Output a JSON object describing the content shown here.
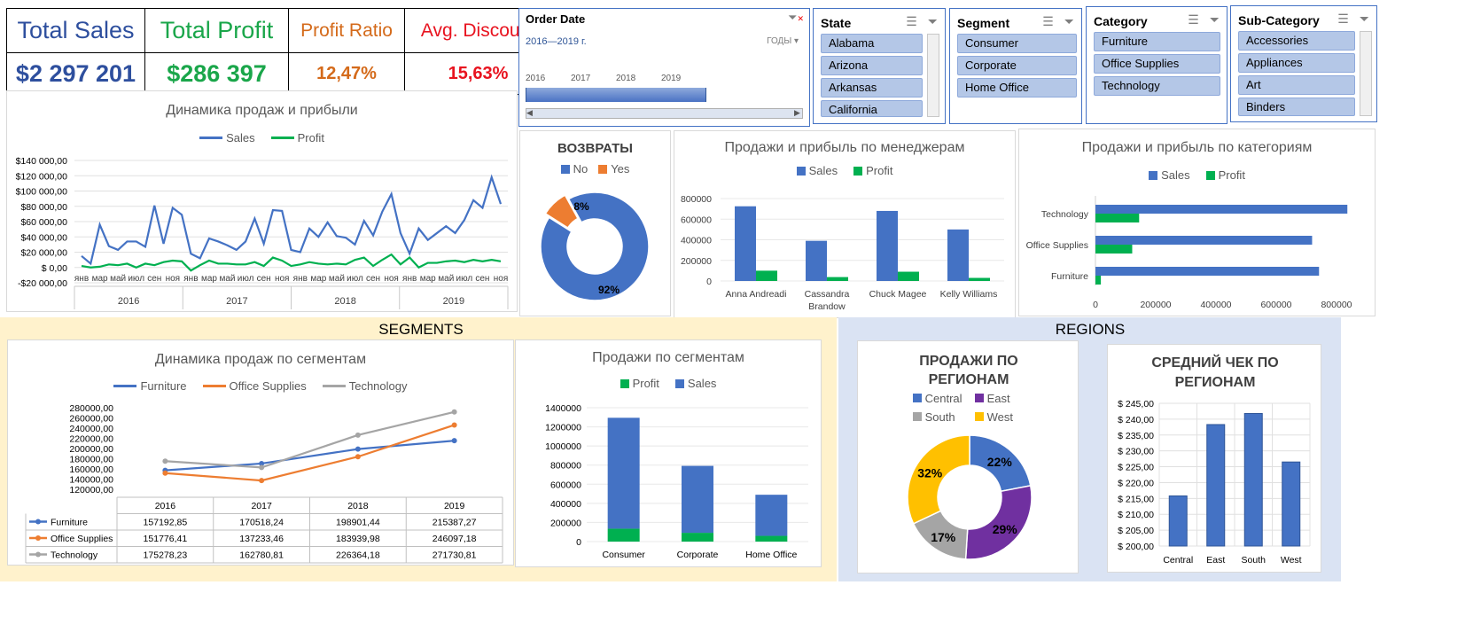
{
  "kpi": {
    "headers": [
      "Total Sales",
      "Total Profit",
      "Profit Ratio",
      "Avg. Discount"
    ],
    "values": [
      "$2 297 201",
      "$286 397",
      "12,47%",
      "15,63%"
    ],
    "colors": [
      "#2e4f9e",
      "#1aa64a",
      "#d46a1a",
      "#e8131f"
    ]
  },
  "order_date": {
    "title": "Order Date",
    "range": "2016—2019 г.",
    "unit": "ГОДЫ",
    "years": [
      "2016",
      "2017",
      "2018",
      "2019"
    ]
  },
  "slicers": {
    "state": {
      "title": "State",
      "items": [
        "Alabama",
        "Arizona",
        "Arkansas",
        "California"
      ]
    },
    "segment": {
      "title": "Segment",
      "items": [
        "Consumer",
        "Corporate",
        "Home Office"
      ]
    },
    "category": {
      "title": "Category",
      "items": [
        "Furniture",
        "Office Supplies",
        "Technology"
      ]
    },
    "subcategory": {
      "title": "Sub-Category",
      "items": [
        "Accessories",
        "Appliances",
        "Art",
        "Binders"
      ]
    }
  },
  "sections": {
    "segments": "SEGMENTS",
    "regions": "REGIONS"
  },
  "charts": {
    "dynamics": {
      "title": "Динамика продаж и прибыли",
      "legend": [
        "Sales",
        "Profit"
      ],
      "yticks": [
        "$140 000,00",
        "$120 000,00",
        "$100 000,00",
        "$80 000,00",
        "$60 000,00",
        "$40 000,00",
        "$20 000,00",
        "$ 0,00",
        "-$20 000,00"
      ],
      "years": [
        "2016",
        "2017",
        "2018",
        "2019"
      ],
      "months_short": [
        "янв",
        "мар",
        "май",
        "июл",
        "сен",
        "ноя"
      ]
    },
    "returns": {
      "title": "ВОЗВРАТЫ",
      "legend": [
        "No",
        "Yes"
      ],
      "labels": [
        "92%",
        "8%"
      ]
    },
    "managers": {
      "title": "Продажи и прибыль по менеджерам",
      "legend": [
        "Sales",
        "Profit"
      ]
    },
    "categories": {
      "title": "Продажи и прибыль по категориям",
      "legend": [
        "Sales",
        "Profit"
      ]
    },
    "seg_dynamics": {
      "title": "Динамика продаж по сегментам",
      "legend": [
        "Furniture",
        "Office Supplies",
        "Technology"
      ],
      "yticks": [
        "280000,00",
        "260000,00",
        "240000,00",
        "220000,00",
        "200000,00",
        "180000,00",
        "160000,00",
        "140000,00",
        "120000,00"
      ],
      "years": [
        "2016",
        "2017",
        "2018",
        "2019"
      ],
      "table": [
        [
          "157192,85",
          "170518,24",
          "198901,44",
          "215387,27"
        ],
        [
          "151776,41",
          "137233,46",
          "183939,98",
          "246097,18"
        ],
        [
          "175278,23",
          "162780,81",
          "226364,18",
          "271730,81"
        ]
      ]
    },
    "seg_sales": {
      "title": "Продажи по сегментам",
      "legend": [
        "Profit",
        "Sales"
      ]
    },
    "region_sales": {
      "title": "ПРОДАЖИ ПО РЕГИОНАМ",
      "legend": [
        "Central",
        "East",
        "South",
        "West"
      ],
      "labels": [
        "22%",
        "29%",
        "17%",
        "32%"
      ]
    },
    "avg_check": {
      "title": "СРЕДНИЙ ЧЕК ПО РЕГИОНАМ",
      "yticks": [
        "$ 245,00",
        "$ 240,00",
        "$ 235,00",
        "$ 230,00",
        "$ 225,00",
        "$ 220,00",
        "$ 215,00",
        "$ 210,00",
        "$ 205,00",
        "$ 200,00"
      ]
    }
  },
  "chart_data": [
    {
      "type": "line",
      "title": "Динамика продаж и прибыли",
      "x": [
        "2016-01",
        "2016-02",
        "2016-03",
        "2016-04",
        "2016-05",
        "2016-06",
        "2016-07",
        "2016-08",
        "2016-09",
        "2016-10",
        "2016-11",
        "2016-12",
        "2017-01",
        "2017-02",
        "2017-03",
        "2017-04",
        "2017-05",
        "2017-06",
        "2017-07",
        "2017-08",
        "2017-09",
        "2017-10",
        "2017-11",
        "2017-12",
        "2018-01",
        "2018-02",
        "2018-03",
        "2018-04",
        "2018-05",
        "2018-06",
        "2018-07",
        "2018-08",
        "2018-09",
        "2018-10",
        "2018-11",
        "2018-12",
        "2019-01",
        "2019-02",
        "2019-03",
        "2019-04",
        "2019-05",
        "2019-06",
        "2019-07",
        "2019-08",
        "2019-09",
        "2019-10",
        "2019-11",
        "2019-12"
      ],
      "series": [
        {
          "name": "Sales",
          "color": "#4472c4",
          "values": [
            15000,
            5000,
            56000,
            28000,
            23000,
            34000,
            34000,
            27000,
            81000,
            31000,
            78000,
            69000,
            18000,
            12000,
            38000,
            34000,
            29000,
            23000,
            34000,
            64000,
            31000,
            75000,
            74000,
            23000,
            20000,
            51000,
            40000,
            59000,
            41000,
            39000,
            30000,
            61000,
            42000,
            73000,
            96000,
            45000,
            18000,
            51000,
            36000,
            45000,
            54000,
            45000,
            62000,
            88000,
            78000,
            118000,
            83000,
            0
          ]
        },
        {
          "name": "Profit",
          "color": "#00b050",
          "values": [
            2000,
            0,
            1000,
            4000,
            3000,
            5000,
            0,
            5000,
            3000,
            7000,
            9000,
            8000,
            -4000,
            3000,
            9000,
            5000,
            5000,
            4000,
            4000,
            7000,
            2000,
            13000,
            9000,
            2000,
            4000,
            7000,
            5000,
            4000,
            5000,
            4000,
            10000,
            13000,
            2000,
            10000,
            17000,
            4000,
            13000,
            0,
            6000,
            6000,
            8000,
            9000,
            7000,
            10000,
            8000,
            10000,
            8000,
            0
          ]
        }
      ],
      "ylim": [
        -20000,
        140000
      ],
      "legend": "top"
    },
    {
      "type": "pie",
      "title": "ВОЗВРАТЫ",
      "categories": [
        "No",
        "Yes"
      ],
      "values": [
        92,
        8
      ],
      "colors": [
        "#4472c4",
        "#ed7d31"
      ]
    },
    {
      "type": "bar",
      "title": "Продажи и прибыль по менеджерам",
      "categories": [
        "Anna Andreadi",
        "Cassandra Brandow",
        "Chuck Magee",
        "Kelly Williams"
      ],
      "series": [
        {
          "name": "Sales",
          "values": [
            725000,
            390000,
            680000,
            500000
          ]
        },
        {
          "name": "Profit",
          "values": [
            100000,
            38000,
            90000,
            30000
          ]
        }
      ],
      "ylim": [
        0,
        800000
      ]
    },
    {
      "type": "bar",
      "title": "Продажи и прибыль по категориям",
      "categories": [
        "Furniture",
        "Office Supplies",
        "Technology"
      ],
      "series": [
        {
          "name": "Sales",
          "values": [
            742000,
            719000,
            836000
          ]
        },
        {
          "name": "Profit",
          "values": [
            18000,
            122000,
            145000
          ]
        }
      ],
      "xlim": [
        0,
        800000
      ],
      "orientation": "horizontal"
    },
    {
      "type": "line",
      "title": "Динамика продаж по сегментам",
      "categories": [
        "2016",
        "2017",
        "2018",
        "2019"
      ],
      "series": [
        {
          "name": "Furniture",
          "values": [
            157192.85,
            170518.24,
            198901.44,
            215387.27
          ]
        },
        {
          "name": "Office Supplies",
          "values": [
            151776.41,
            137233.46,
            183939.98,
            246097.18
          ]
        },
        {
          "name": "Technology",
          "values": [
            175278.23,
            162780.81,
            226364.18,
            271730.81
          ]
        }
      ],
      "ylim": [
        120000,
        280000
      ]
    },
    {
      "type": "bar",
      "title": "Продажи по сегментам",
      "categories": [
        "Consumer",
        "Corporate",
        "Home Office"
      ],
      "series": [
        {
          "name": "Profit",
          "values": [
            135000,
            92000,
            60000
          ]
        },
        {
          "name": "Sales",
          "values": [
            1160000,
            700000,
            430000
          ]
        }
      ],
      "stacked": true,
      "ylim": [
        0,
        1400000
      ]
    },
    {
      "type": "pie",
      "title": "ПРОДАЖИ ПО РЕГИОНАМ",
      "categories": [
        "Central",
        "East",
        "South",
        "West"
      ],
      "values": [
        22,
        29,
        17,
        32
      ],
      "colors": [
        "#4472c4",
        "#7030a0",
        "#a5a5a5",
        "#ffc000"
      ]
    },
    {
      "type": "bar",
      "title": "СРЕДНИЙ ЧЕК ПО РЕГИОНАМ",
      "categories": [
        "Central",
        "East",
        "South",
        "West"
      ],
      "values": [
        215.8,
        238.3,
        241.8,
        226.5
      ],
      "ylim": [
        200,
        245
      ]
    }
  ]
}
